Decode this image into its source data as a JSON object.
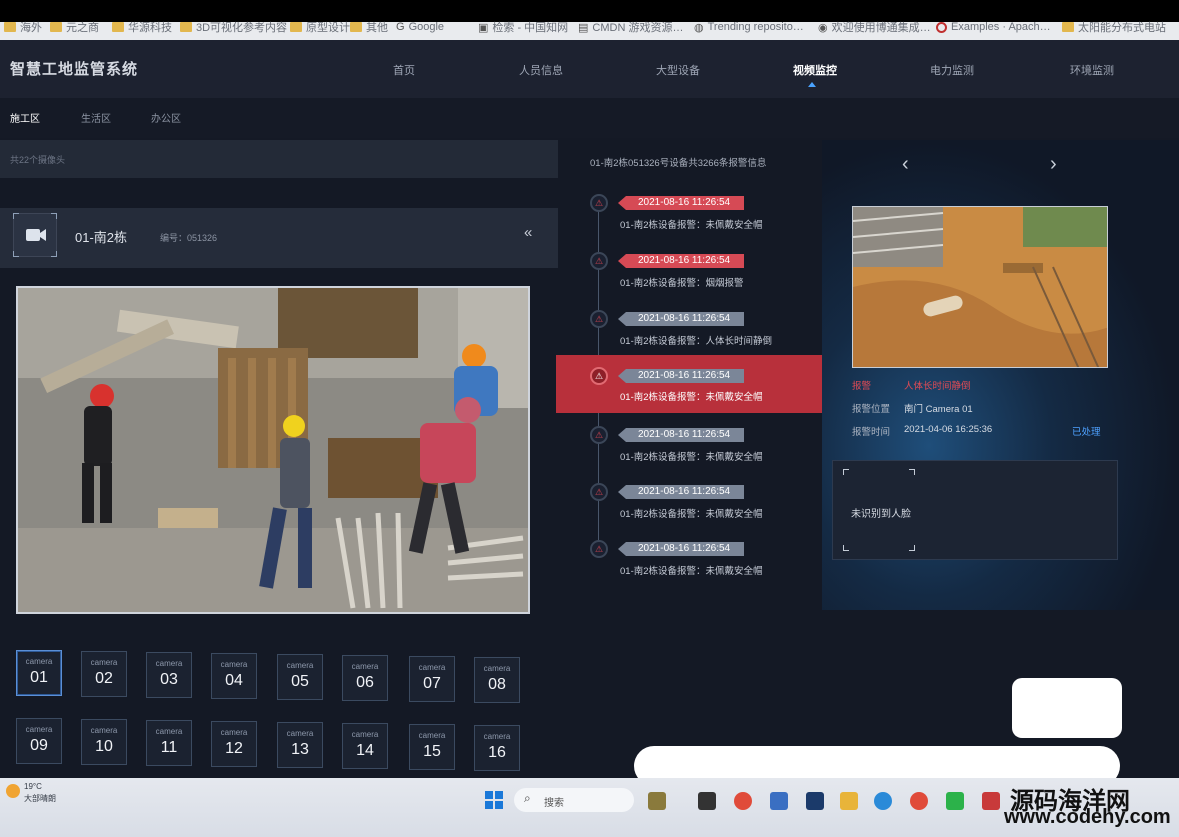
{
  "bookmarks": [
    {
      "label": "海外",
      "icon": "folder-icon"
    },
    {
      "label": "元之商",
      "icon": "folder-icon"
    },
    {
      "label": "华源科技",
      "icon": "folder-icon"
    },
    {
      "label": "3D可视化参考内容",
      "icon": "folder-icon"
    },
    {
      "label": "原型设计",
      "icon": "folder-icon"
    },
    {
      "label": "其他",
      "icon": "folder-icon"
    },
    {
      "label": "Google",
      "icon": "google-icon"
    },
    {
      "label": "检索 - 中国知网",
      "icon": "cnki-icon"
    },
    {
      "label": "CMDN 游戏资源…",
      "icon": "page-icon"
    },
    {
      "label": "Trending reposito…",
      "icon": "github-icon"
    },
    {
      "label": "欢迎使用博通集成…",
      "icon": "page-icon"
    },
    {
      "label": "Examples · Apach…",
      "icon": "echarts-icon"
    },
    {
      "label": "太阳能分布式电站",
      "icon": "folder-icon"
    }
  ],
  "app": {
    "title": "智慧工地监管系统",
    "nav": [
      {
        "label": "首页",
        "active": false
      },
      {
        "label": "人员信息",
        "active": false
      },
      {
        "label": "大型设备",
        "active": false
      },
      {
        "label": "视频监控",
        "active": true
      },
      {
        "label": "电力监测",
        "active": false
      },
      {
        "label": "环境监测",
        "active": false
      }
    ],
    "zones": [
      {
        "label": "施工区",
        "active": true
      },
      {
        "label": "生活区",
        "active": false
      },
      {
        "label": "办公区",
        "active": false
      }
    ],
    "camera_count": "共22个摄像头",
    "current_camera": {
      "name": "01-南2栋",
      "code_label": "编号：051326",
      "collapse_glyph": "«"
    },
    "cameras": [
      {
        "label": "camera",
        "num": "01",
        "active": true
      },
      {
        "label": "camera",
        "num": "02",
        "active": false
      },
      {
        "label": "camera",
        "num": "03",
        "active": false
      },
      {
        "label": "camera",
        "num": "04",
        "active": false
      },
      {
        "label": "camera",
        "num": "05",
        "active": false
      },
      {
        "label": "camera",
        "num": "06",
        "active": false
      },
      {
        "label": "camera",
        "num": "07",
        "active": false
      },
      {
        "label": "camera",
        "num": "08",
        "active": false
      },
      {
        "label": "camera",
        "num": "09",
        "active": false
      },
      {
        "label": "camera",
        "num": "10",
        "active": false
      },
      {
        "label": "camera",
        "num": "11",
        "active": false
      },
      {
        "label": "camera",
        "num": "12",
        "active": false
      },
      {
        "label": "camera",
        "num": "13",
        "active": false
      },
      {
        "label": "camera",
        "num": "14",
        "active": false
      },
      {
        "label": "camera",
        "num": "15",
        "active": false
      },
      {
        "label": "camera",
        "num": "16",
        "active": false
      }
    ],
    "timeline": {
      "title": "01-南2栋051326号设备共3266条报警信息",
      "items": [
        {
          "time": "2021-08-16  11:26:54",
          "desc": "01-南2栋设备报警：未佩戴安全帽",
          "severity": "red",
          "active": false
        },
        {
          "time": "2021-08-16  11:26:54",
          "desc": "01-南2栋设备报警：烟烟报警",
          "severity": "red",
          "active": false
        },
        {
          "time": "2021-08-16  11:26:54",
          "desc": "01-南2栋设备报警：人体长时间静倒",
          "severity": "gray",
          "active": false
        },
        {
          "time": "2021-08-16  11:26:54",
          "desc": "01-南2栋设备报警：未佩戴安全帽",
          "severity": "gray",
          "active": true
        },
        {
          "time": "2021-08-16  11:26:54",
          "desc": "01-南2栋设备报警：未佩戴安全帽",
          "severity": "gray",
          "active": false
        },
        {
          "time": "2021-08-16  11:26:54",
          "desc": "01-南2栋设备报警：未佩戴安全帽",
          "severity": "gray",
          "active": false
        },
        {
          "time": "2021-08-16  11:26:54",
          "desc": "01-南2栋设备报警：未佩戴安全帽",
          "severity": "gray",
          "active": false
        }
      ]
    },
    "alarm_detail": {
      "prev_glyph": "‹",
      "next_glyph": "›",
      "type_key": "报警",
      "type_value": "人体长时间静倒",
      "location_key": "报警位置",
      "location_value": "南门 Camera 01",
      "time_key": "报警时间",
      "time_value": "2021-04-06  16:25:36",
      "action": "已处理",
      "face_message": "未识别到人脸"
    },
    "colors": {
      "accent": "#4ea1ff",
      "alarm_red": "#d64a55",
      "panel": "#1d2230"
    }
  },
  "taskbar": {
    "weather_temp": "19°C",
    "weather_desc": "大部晴朗",
    "search_label": "搜索",
    "watermark_cn": "源码海洋网",
    "watermark_url": "www.codehy.com"
  }
}
